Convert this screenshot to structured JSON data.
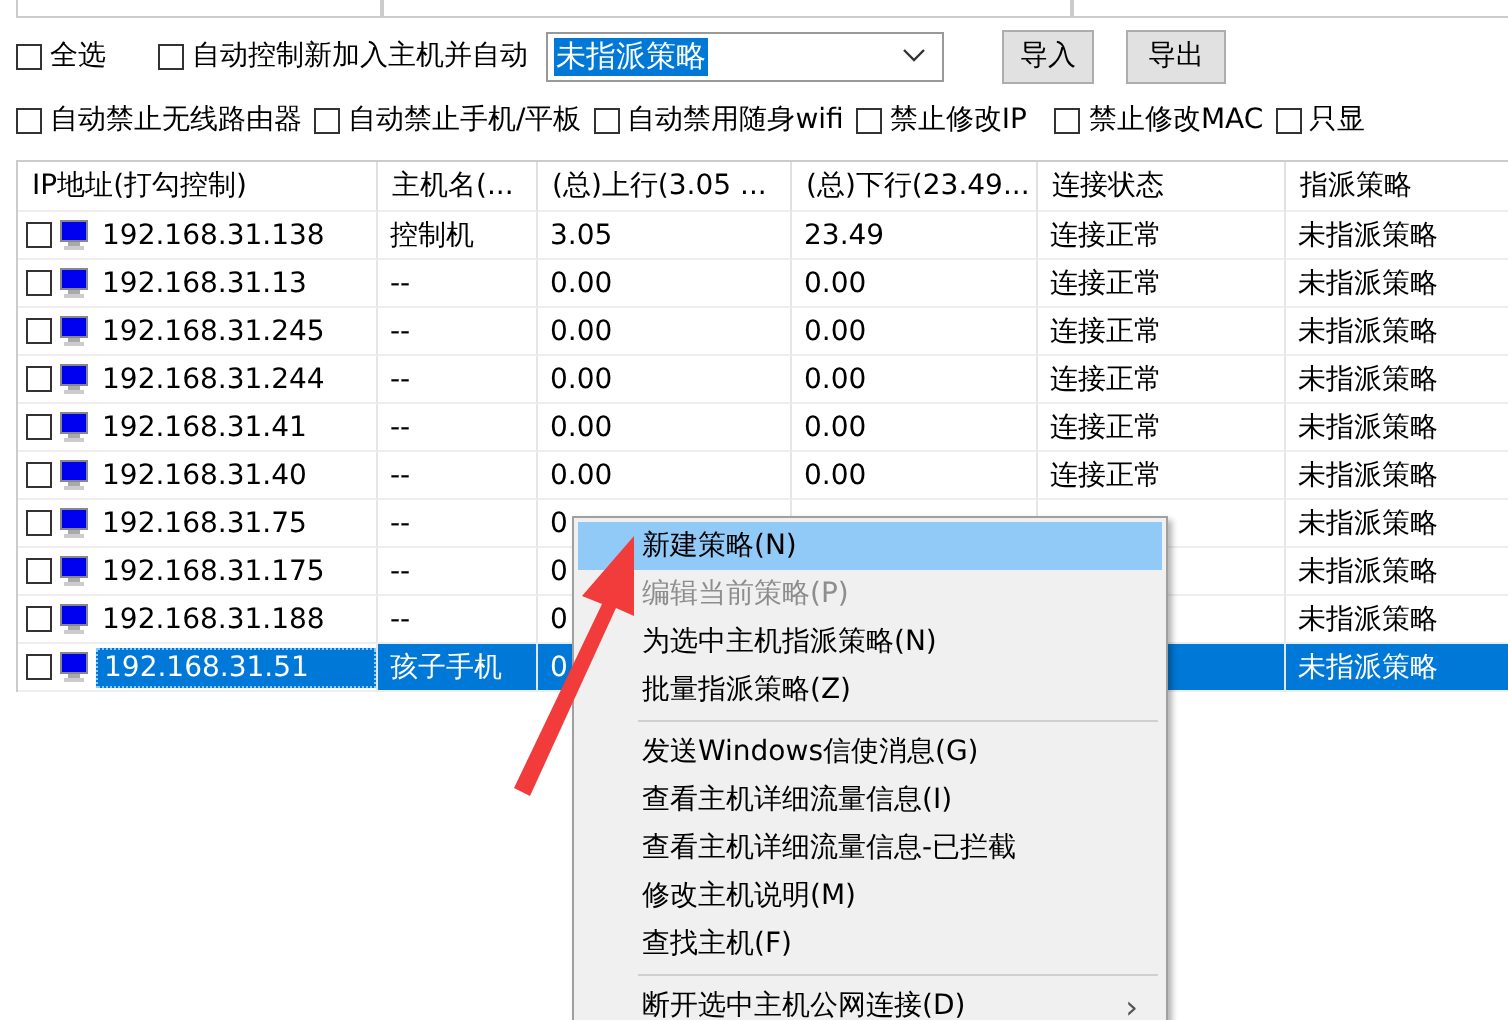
{
  "toolbar": {
    "select_all": {
      "label": "全选",
      "checked": false
    },
    "auto_control": {
      "label": "自动控制新加入主机并自动",
      "checked": false
    },
    "policy_combo": {
      "value": "未指派策略"
    },
    "buttons": [
      "导入",
      "导出"
    ]
  },
  "options": [
    {
      "label": "自动禁止无线路由器",
      "checked": false
    },
    {
      "label": "自动禁止手机/平板",
      "checked": false
    },
    {
      "label": "自动禁用随身wifi",
      "checked": false
    },
    {
      "label": "禁止修改IP",
      "checked": false
    },
    {
      "label": "禁止修改MAC",
      "checked": false
    },
    {
      "label": "只显",
      "checked": false
    }
  ],
  "table": {
    "columns": [
      "IP地址(打勾控制)",
      "主机名(...",
      "(总)上行(3.05 ...",
      "(总)下行(23.49...",
      "连接状态",
      "指派策略"
    ],
    "rows": [
      {
        "checked": false,
        "selected": false,
        "ip": "192.168.31.138",
        "host": "控制机",
        "up": "3.05",
        "down": "23.49",
        "status": "连接正常",
        "policy": "未指派策略"
      },
      {
        "checked": false,
        "selected": false,
        "ip": "192.168.31.13",
        "host": "--",
        "up": "0.00",
        "down": "0.00",
        "status": "连接正常",
        "policy": "未指派策略"
      },
      {
        "checked": false,
        "selected": false,
        "ip": "192.168.31.245",
        "host": "--",
        "up": "0.00",
        "down": "0.00",
        "status": "连接正常",
        "policy": "未指派策略"
      },
      {
        "checked": false,
        "selected": false,
        "ip": "192.168.31.244",
        "host": "--",
        "up": "0.00",
        "down": "0.00",
        "status": "连接正常",
        "policy": "未指派策略"
      },
      {
        "checked": false,
        "selected": false,
        "ip": "192.168.31.41",
        "host": "--",
        "up": "0.00",
        "down": "0.00",
        "status": "连接正常",
        "policy": "未指派策略"
      },
      {
        "checked": false,
        "selected": false,
        "ip": "192.168.31.40",
        "host": "--",
        "up": "0.00",
        "down": "0.00",
        "status": "连接正常",
        "policy": "未指派策略"
      },
      {
        "checked": false,
        "selected": false,
        "ip": "192.168.31.75",
        "host": "--",
        "up": "0",
        "policy": "未指派策略"
      },
      {
        "checked": false,
        "selected": false,
        "ip": "192.168.31.175",
        "host": "--",
        "up": "0",
        "policy": "未指派策略"
      },
      {
        "checked": false,
        "selected": false,
        "ip": "192.168.31.188",
        "host": "--",
        "up": "0",
        "policy": "未指派策略"
      },
      {
        "checked": false,
        "selected": true,
        "ip": "192.168.31.51",
        "host": "孩子手机",
        "up": "0",
        "policy": "未指派策略"
      }
    ]
  },
  "context_menu": {
    "items": [
      {
        "kind": "item",
        "label": "新建策略(N)",
        "selected": true,
        "disabled": false
      },
      {
        "kind": "item",
        "label": "编辑当前策略(P)",
        "selected": false,
        "disabled": true
      },
      {
        "kind": "item",
        "label": "为选中主机指派策略(N)",
        "selected": false,
        "disabled": false
      },
      {
        "kind": "item",
        "label": "批量指派策略(Z)",
        "selected": false,
        "disabled": false
      },
      {
        "kind": "separator"
      },
      {
        "kind": "item",
        "label": "发送Windows信使消息(G)",
        "selected": false,
        "disabled": false
      },
      {
        "kind": "item",
        "label": "查看主机详细流量信息(I)",
        "selected": false,
        "disabled": false
      },
      {
        "kind": "item",
        "label": "查看主机详细流量信息-已拦截",
        "selected": false,
        "disabled": false
      },
      {
        "kind": "item",
        "label": "修改主机说明(M)",
        "selected": false,
        "disabled": false
      },
      {
        "kind": "item",
        "label": "查找主机(F)",
        "selected": false,
        "disabled": false
      },
      {
        "kind": "separator"
      },
      {
        "kind": "submenu",
        "label": "断开选中主机公网连接(D)",
        "arrow": "›",
        "selected": false,
        "disabled": false
      }
    ]
  }
}
